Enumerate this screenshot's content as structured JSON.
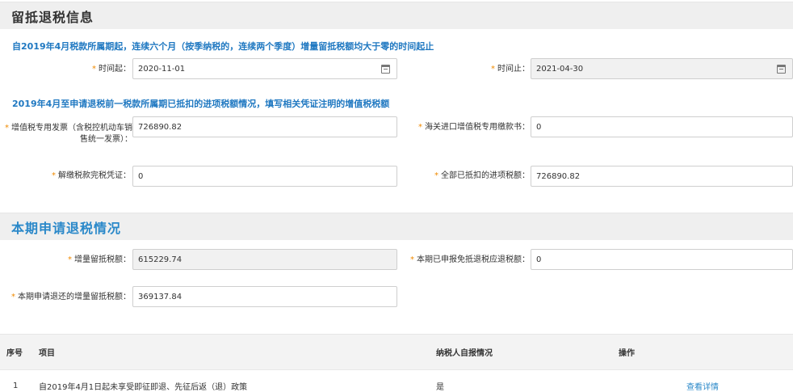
{
  "section1": {
    "title": "留抵退税信息",
    "notice1": "自2019年4月税款所属期起，连续六个月（按季纳税的，连续两个季度）增量留抵税额均大于零的时间起止",
    "notice2": "2019年4月至申请退税前一税款所属期已抵扣的进项税额情况，填写相关凭证注明的增值税税额"
  },
  "fields": {
    "start_label": "时间起：",
    "start_value": "2020-11-01",
    "end_label": "时间止：",
    "end_value": "2021-04-30",
    "vat_invoice_label_1": "增值税专用发票（含税控机动车销",
    "vat_invoice_label_2": "售统一发票）：",
    "vat_invoice_value": "726890.82",
    "customs_label": "海关进口增值税专用缴款书：",
    "customs_value": "0",
    "tax_cert_label": "解缴税款完税凭证：",
    "tax_cert_value": "0",
    "total_label": "全部已抵扣的进项税额：",
    "total_value": "726890.82"
  },
  "section2": {
    "title": "本期申请退税情况",
    "increment_label": "增量留抵税额：",
    "increment_value": "615229.74",
    "declared_label": "本期已申报免抵退税应退税额：",
    "declared_value": "0",
    "apply_label": "本期申请退还的增量留抵税额：",
    "apply_value": "369137.84"
  },
  "table": {
    "headers": [
      "序号",
      "项目",
      "纳税人自报情况",
      "操作"
    ],
    "rows": [
      {
        "no": "1",
        "item": "自2019年4月1日起未享受即征即退、先征后返（退）政策",
        "status": "是",
        "action": "查看详情"
      }
    ]
  }
}
